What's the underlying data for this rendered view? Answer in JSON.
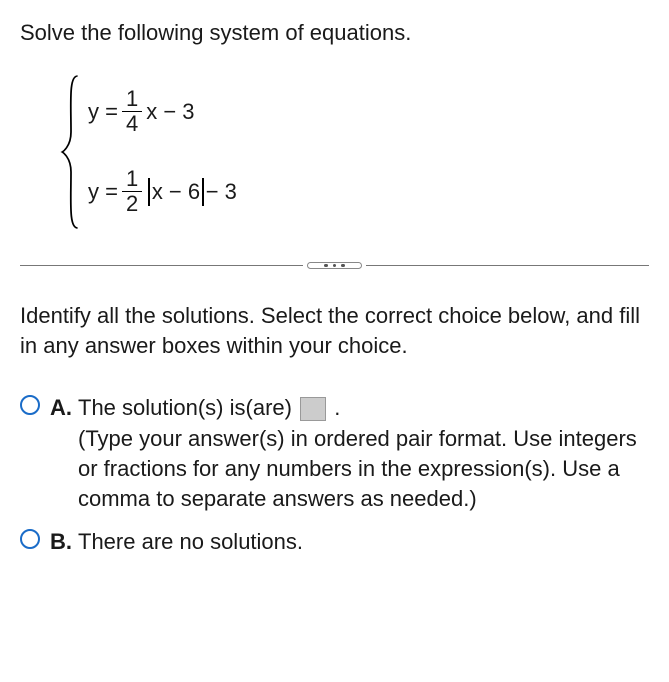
{
  "prompt": "Solve the following system of equations.",
  "eq1": {
    "lhs": "y = ",
    "frac_num": "1",
    "frac_den": "4",
    "rhs": "x − 3"
  },
  "eq2": {
    "lhs": "y = ",
    "frac_num": "1",
    "frac_den": "2",
    "abs_inner": "x − 6",
    "tail": " − 3"
  },
  "instruction": "Identify all the solutions. Select the correct choice below, and fill in any answer boxes within your choice.",
  "choices": {
    "A": {
      "letter": "A.",
      "line1_pre": "The solution(s) is(are) ",
      "line1_post": " .",
      "help": "(Type your answer(s) in ordered pair format. Use integers or fractions for any numbers in the expression(s). Use a comma to separate answers as needed.)"
    },
    "B": {
      "letter": "B.",
      "text": "There are no solutions."
    }
  }
}
